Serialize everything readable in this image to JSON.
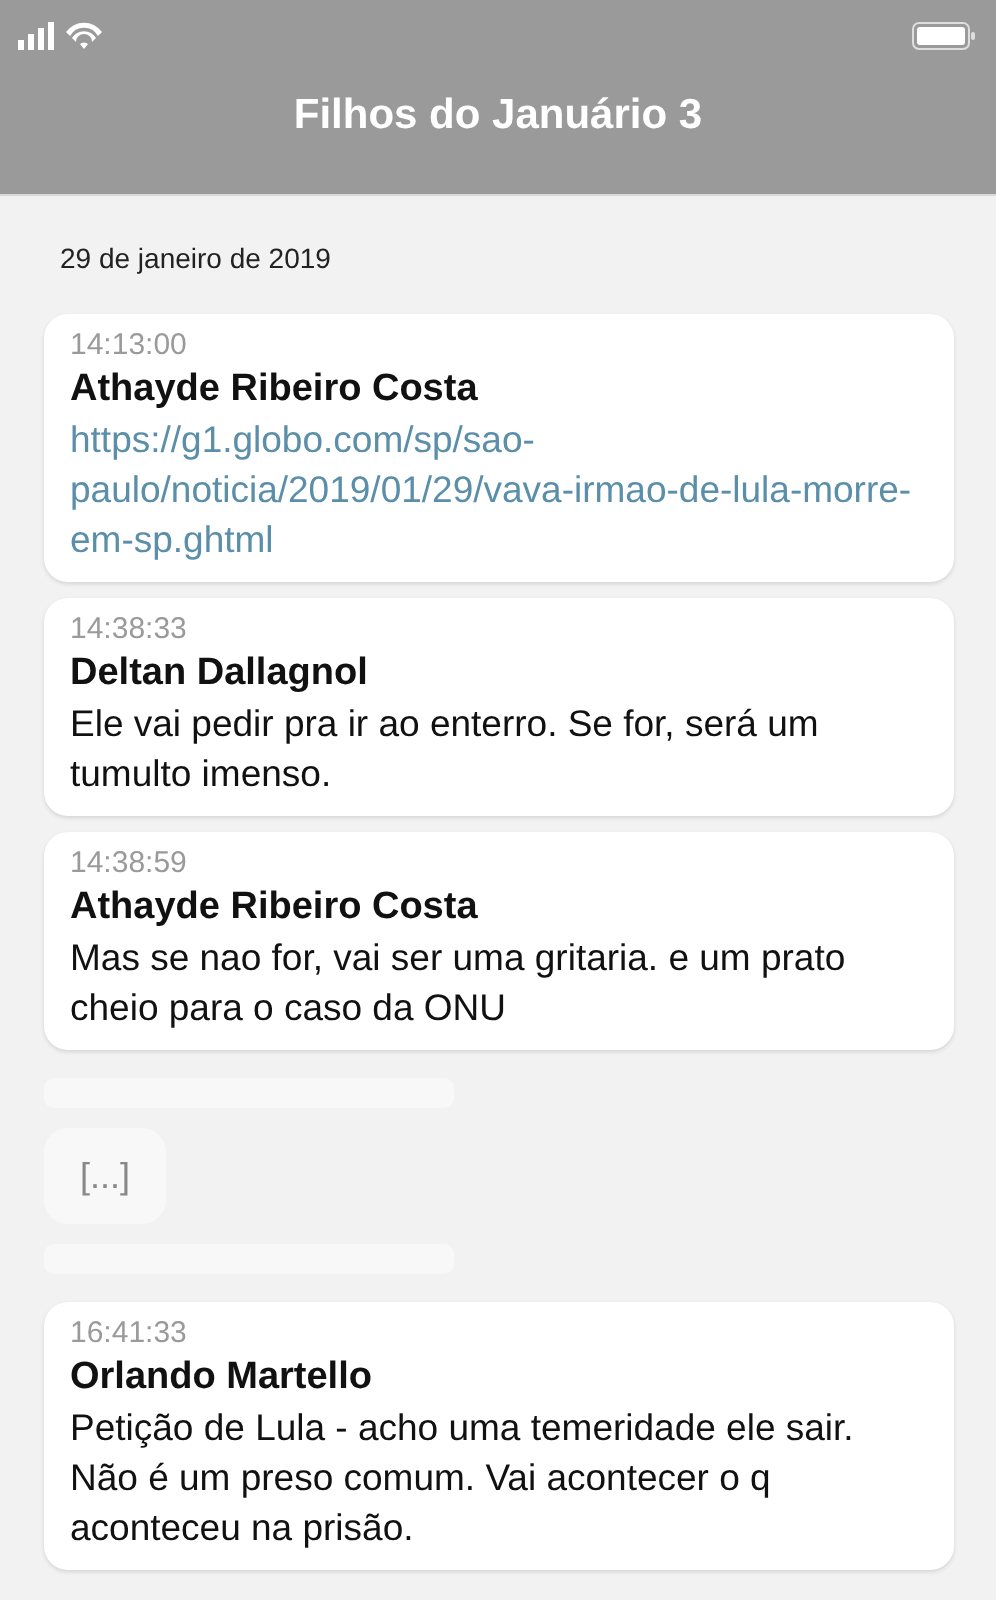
{
  "header": {
    "title": "Filhos do Januário 3"
  },
  "date": "29 de janeiro de 2019",
  "messages": [
    {
      "kind": "message",
      "time": "14:13:00",
      "author": "Athayde Ribeiro Costa",
      "text": "https://g1.globo.com/sp/sao-paulo/noticia/2019/01/29/vava-irmao-de-lula-morre-em-sp.ghtml",
      "link": true
    },
    {
      "kind": "message",
      "time": "14:38:33",
      "author": "Deltan Dallagnol",
      "text": "Ele vai pedir pra ir ao enterro. Se for, será um tumulto imenso.",
      "link": false
    },
    {
      "kind": "message",
      "time": "14:38:59",
      "author": "Athayde Ribeiro Costa",
      "text": "Mas se nao for, vai ser uma gritaria. e um prato cheio para o caso da ONU",
      "link": false
    },
    {
      "kind": "gap",
      "text": "[...]"
    },
    {
      "kind": "message",
      "time": "16:41:33",
      "author": "Orlando Martello",
      "text": "Petição de Lula - acho uma temeridade ele sair. Não é um preso comum. Vai acontecer o q aconteceu na prisão.",
      "link": false
    }
  ]
}
